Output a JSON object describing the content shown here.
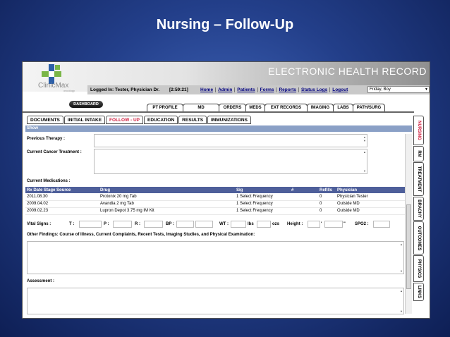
{
  "slide_title": "Nursing – Follow-Up",
  "app": {
    "logo": {
      "name": "ClinicMax",
      "sub": "oncology"
    },
    "header_title": "ELECTRONIC HEALTH RECORD",
    "logged_in": "Logged In: Tester, Physician Dr.",
    "timer": "[2:59:21]",
    "nav_links": [
      "Home",
      "Admin",
      "Patients",
      "Forms",
      "Reports",
      "Status Logs",
      "Logout"
    ],
    "patient_select": "Friday, Boy",
    "dashboard_button": "DASHBOARD",
    "upper_tabs": [
      "PT PROFILE",
      "MD",
      "ORDERS",
      "MEDS",
      "EXT RECORDS",
      "IMAGING",
      "LABS",
      "PATH/SURG"
    ],
    "lower_tabs": [
      "DOCUMENTS",
      "INITIAL INTAKE",
      "FOLLOW - UP",
      "EDUCATION",
      "RESULTS",
      "IMMUNIZATIONS"
    ],
    "active_lower_tab": "FOLLOW - UP",
    "show_label": "Show",
    "side_tabs": [
      "NURSING",
      "RM",
      "TREATMENT",
      "BRACHY",
      "OUTCOMES",
      "PHYSICS",
      "LINKS"
    ],
    "active_side_tab": "NURSING",
    "accent_color": "#d02040",
    "table_header_color": "#4e5f9a"
  },
  "form": {
    "previous_therapy_label": "Previous Therapy :",
    "current_cancer_treatment_label": "Current Cancer Treatment :",
    "current_medications_label": "Current Medications :",
    "med_columns": [
      "Rx Date",
      "Stage",
      "Source",
      "Drug",
      "Sig",
      "#",
      "Refills",
      "Physician"
    ],
    "medications": [
      {
        "date": "2011.08.30",
        "drug": "Protonix 20 mg Tab",
        "sig": "1 Select Frequency",
        "refills": "0",
        "physician": "Physician Tester"
      },
      {
        "date": "2009.04.02",
        "drug": "Avandia 2 mg Tab",
        "sig": "1 Select Frequency",
        "refills": "0",
        "physician": "Outside MD"
      },
      {
        "date": "2009.02.23",
        "drug": "Lupron Depot 3.75 mg IM Kit",
        "sig": "1 Select Frequency",
        "refills": "0",
        "physician": "Outside MD"
      }
    ],
    "vitals_label": "Vital Signs :",
    "vitals": {
      "t": "T :",
      "p": "P :",
      "r": "R :",
      "bp": "BP :",
      "wt": "WT :",
      "lbs": "lbs",
      "ozs": "ozs",
      "height": "Height :",
      "ft": "'",
      "in": "\"",
      "spo2": "SPO2 :"
    },
    "other_findings_label": "Other Findings: Course of Illness, Current Complaints, Recent Tests, Imaging Studies, and Physical Examination:",
    "assessment_label": "Assessment :"
  }
}
